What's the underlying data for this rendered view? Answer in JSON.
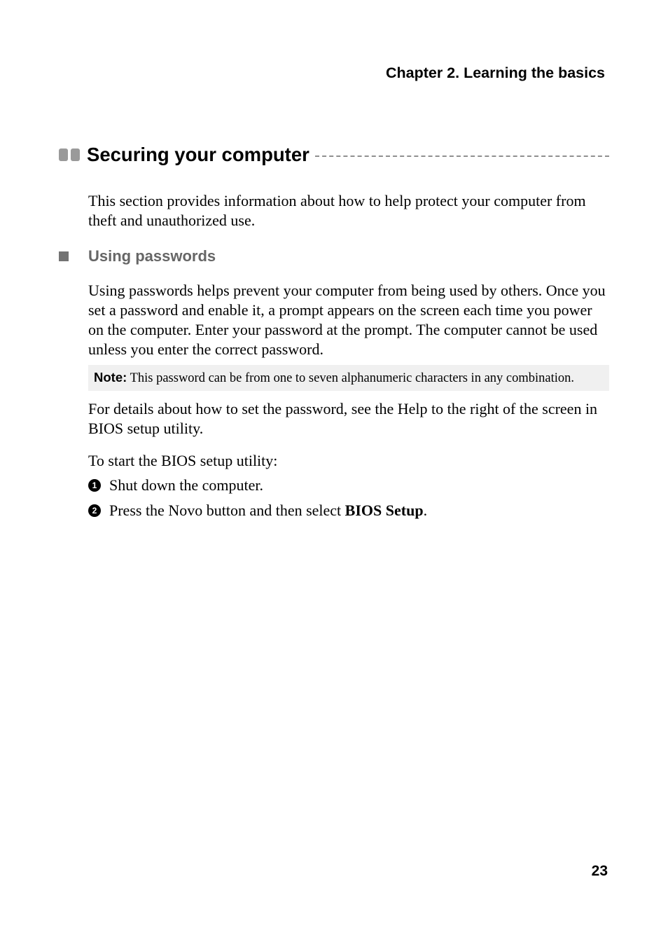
{
  "chapter_header": "Chapter 2. Learning the basics",
  "section": {
    "title": "Securing your computer",
    "intro": "This section provides information about how to help protect your computer from theft and unauthorized use."
  },
  "subsection": {
    "title": "Using passwords",
    "paragraph": "Using passwords helps prevent your computer from being used by others. Once you set a password and enable it, a prompt appears on the screen each time you power on the computer. Enter your password at the prompt. The computer cannot be used unless you enter the correct password."
  },
  "note": {
    "label": "Note:",
    "text": " This password can be from one to seven alphanumeric characters in any combination."
  },
  "after_note": "For details about how to set the password, see the Help to the right of the screen in BIOS setup utility.",
  "steps_intro": "To start the BIOS setup utility:",
  "steps": [
    {
      "num": "1",
      "text": "Shut down the computer."
    },
    {
      "num": "2",
      "prefix": "Press the Novo button and then select ",
      "bold": "BIOS Setup",
      "suffix": "."
    }
  ],
  "page_number": "23"
}
